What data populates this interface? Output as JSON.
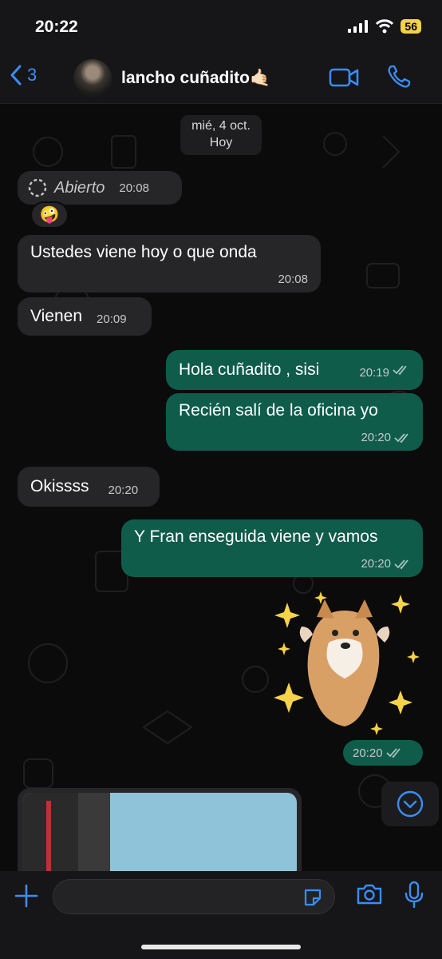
{
  "status": {
    "time": "20:22",
    "battery": "56"
  },
  "header": {
    "back_count": "3",
    "contact_name": "lancho cuñadito🤙🏻"
  },
  "chat": {
    "date": {
      "day": "mié, 4 oct.",
      "label": "Hoy"
    },
    "messages": [
      {
        "dir": "in",
        "text": "Abierto",
        "time": "20:08",
        "kind": "view-once"
      },
      {
        "dir": "in",
        "text": "🤪",
        "kind": "reaction"
      },
      {
        "dir": "in",
        "text": "Ustedes viene hoy o que onda",
        "time": "20:08"
      },
      {
        "dir": "in",
        "text": "Vienen",
        "time": "20:09"
      },
      {
        "dir": "out",
        "text": "Hola cuñadito , sisi",
        "time": "20:19"
      },
      {
        "dir": "out",
        "text": "Recién salí de la oficina yo",
        "time": "20:20"
      },
      {
        "dir": "in",
        "text": "Okissss",
        "time": "20:20"
      },
      {
        "dir": "out",
        "text": "Y Fran enseguida viene y vamos",
        "time": "20:20"
      },
      {
        "dir": "out",
        "text": "",
        "time": "20:20",
        "kind": "sticker"
      }
    ]
  },
  "colors": {
    "accent": "#3c8df5",
    "outgoing": "#0f5c4b",
    "incoming": "#262628",
    "background": "#0b0b0c"
  },
  "icons": [
    "back-chevron-icon",
    "video-call-icon",
    "phone-icon",
    "dashed-circle-icon",
    "read-ticks-icon",
    "scroll-down-icon",
    "plus-icon",
    "sticker-icon",
    "camera-icon",
    "microphone-icon"
  ]
}
